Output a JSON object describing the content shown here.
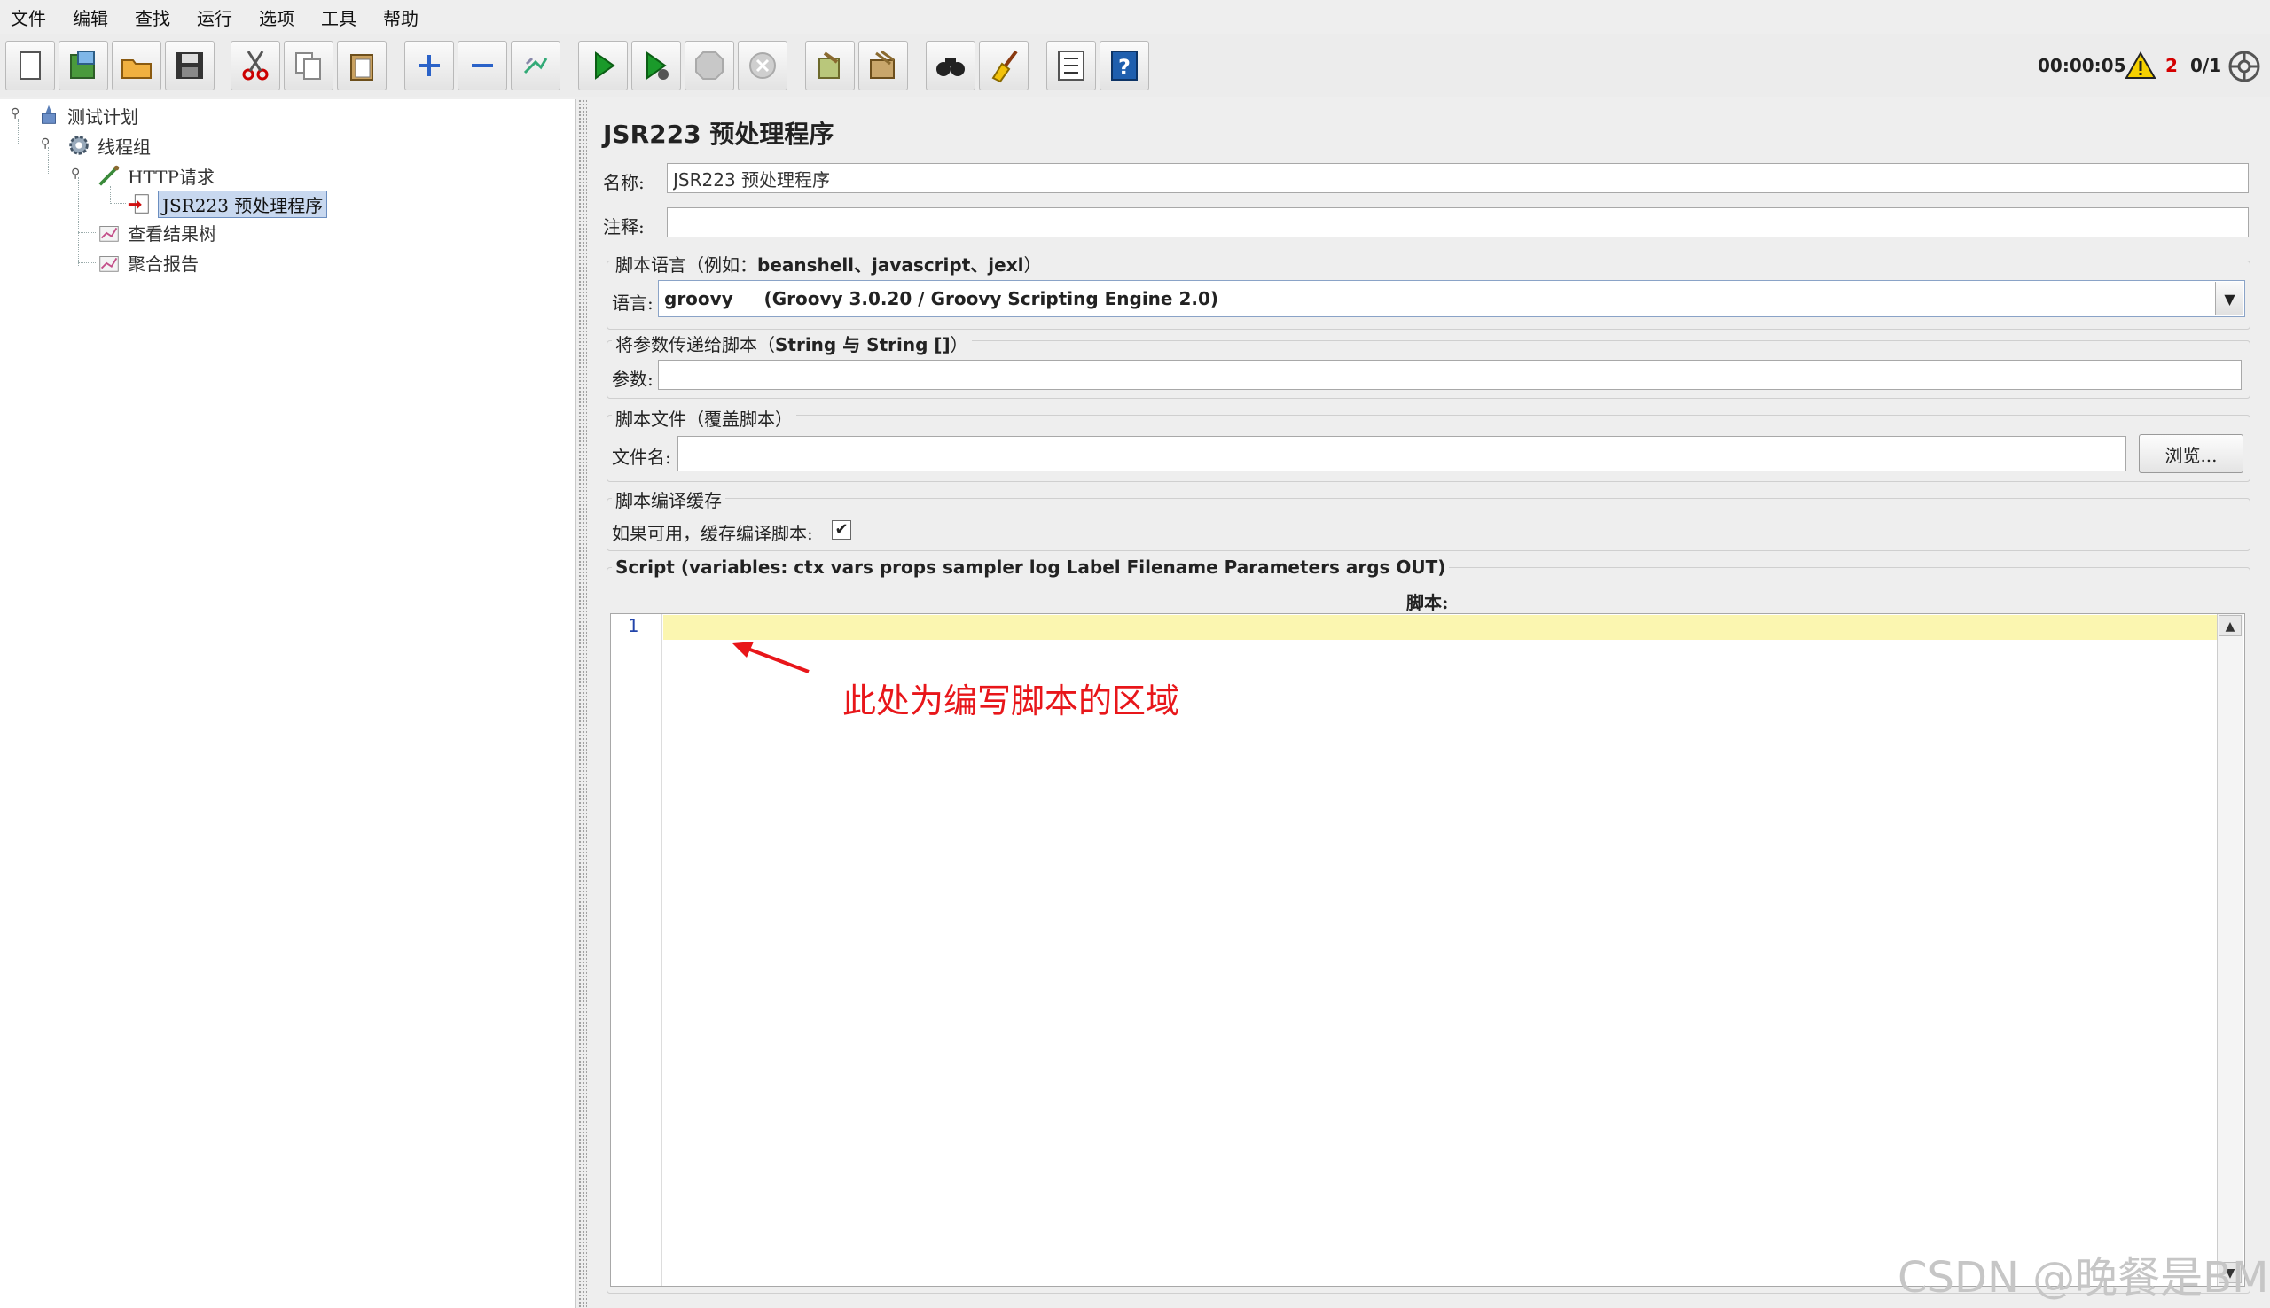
{
  "menu": [
    "文件",
    "编辑",
    "查找",
    "运行",
    "选项",
    "工具",
    "帮助"
  ],
  "toolbar": {
    "icons": [
      "new-icon",
      "templates-icon",
      "open-icon",
      "save-icon",
      "cut-icon",
      "copy-icon",
      "paste-icon",
      "expand-icon",
      "collapse-icon",
      "toggle-icon",
      "start-icon",
      "start-no-pause-icon",
      "stop-icon",
      "shutdown-icon",
      "clear-icon",
      "clear-all-icon",
      "search-icon",
      "reset-search-icon",
      "function-helper-icon",
      "help-icon"
    ]
  },
  "status": {
    "timer": "00:00:05",
    "errors": "2",
    "threads": "0/1"
  },
  "tree": {
    "test_plan": "测试计划",
    "thread_group": "线程组",
    "http_request": "HTTP请求",
    "jsr223": "JSR223 预处理程序",
    "view_results": "查看结果树",
    "aggregate_report": "聚合报告"
  },
  "panel": {
    "title": "JSR223 预处理程序",
    "name_label": "名称:",
    "name_value": "JSR223 预处理程序",
    "comment_label": "注释:",
    "comment_value": "",
    "lang_group_title_cn": "脚本语言（例如：",
    "lang_group_title_en": "beanshell、javascript、jexl",
    "lang_group_title_end": "）",
    "lang_label": "语言:",
    "lang_value": "groovy     (Groovy 3.0.20 / Groovy Scripting Engine 2.0)",
    "params_group_title_cn": "将参数传递给脚本（",
    "params_group_title_en": "String 与 String []",
    "params_group_title_end": "）",
    "params_label": "参数:",
    "params_value": "",
    "file_group_title": "脚本文件（覆盖脚本）",
    "file_label": "文件名:",
    "file_value": "",
    "browse_label": "浏览...",
    "cache_group_title": "脚本编译缓存",
    "cache_label": "如果可用，缓存编译脚本:",
    "cache_checked": "✔",
    "script_group_title": "Script (variables: ctx vars props sampler log Label Filename Parameters args OUT)",
    "script_label": "脚本:",
    "line_number": "1"
  },
  "annotation": "此处为编写脚本的区域",
  "watermark": "CSDN @晚餐是BM",
  "colors": {
    "annotation": "#e8161a",
    "current_line": "#fbf6b0",
    "selection": "#c8d8ef"
  }
}
